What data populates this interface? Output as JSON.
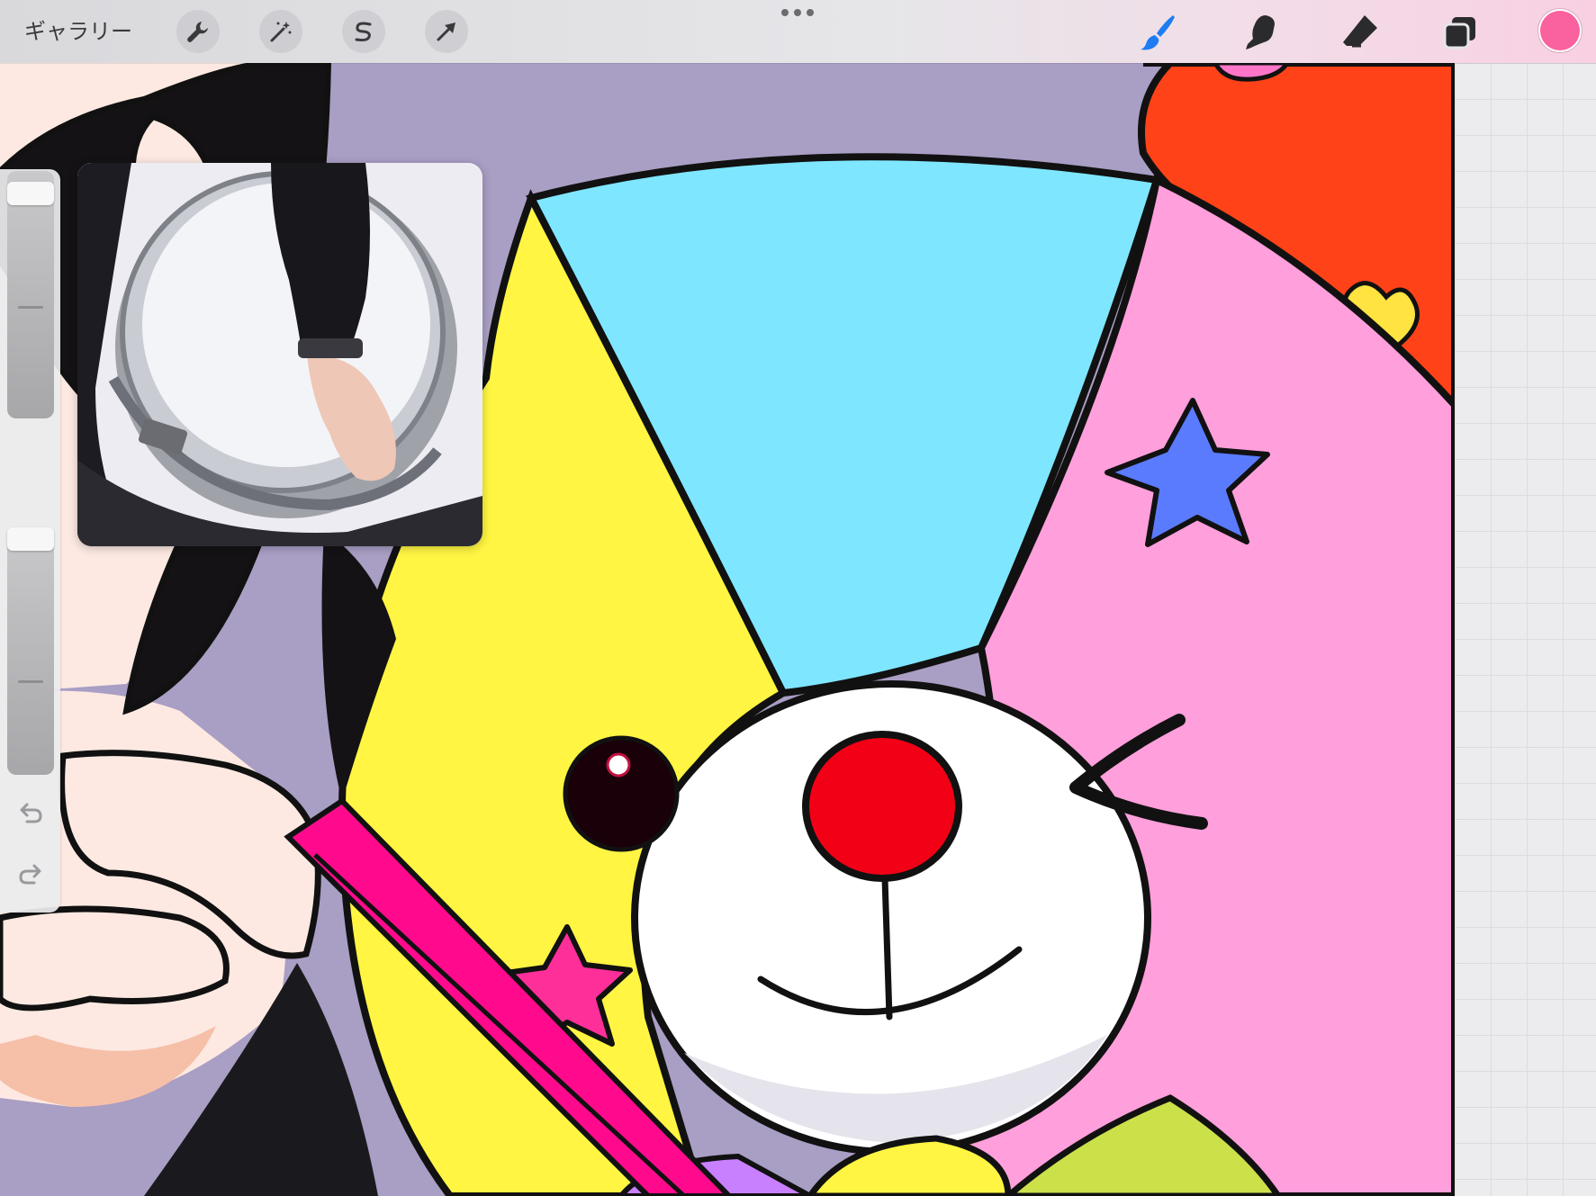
{
  "toolbar": {
    "gallery_label": "ギャラリー",
    "left_tools": [
      {
        "name": "actions",
        "icon": "wrench-icon"
      },
      {
        "name": "adjustments",
        "icon": "magic-wand-icon"
      },
      {
        "name": "selection",
        "icon": "selection-s-icon"
      },
      {
        "name": "transform",
        "icon": "arrow-cursor-icon"
      }
    ],
    "right_tools": [
      {
        "name": "brush",
        "icon": "brush-icon",
        "active": true
      },
      {
        "name": "smudge",
        "icon": "smudge-finger-icon",
        "active": false
      },
      {
        "name": "eraser",
        "icon": "eraser-icon",
        "active": false
      },
      {
        "name": "layers",
        "icon": "layers-icon",
        "active": false
      }
    ],
    "current_color": "#f9629f",
    "active_tool_color": "#1e7cf2"
  },
  "sidebar": {
    "brush_size_level": 0.95,
    "opacity_level": 1.0,
    "buttons": [
      {
        "name": "modify",
        "icon": "square-outline-icon"
      },
      {
        "name": "undo",
        "icon": "undo-arrow-icon"
      },
      {
        "name": "redo",
        "icon": "redo-arrow-icon"
      }
    ]
  },
  "reference_window": {
    "content": "snare-drum-photo"
  },
  "canvas": {
    "palette": {
      "background": "#a99ec4",
      "yellow": "#fff542",
      "blue": "#7fe6ff",
      "pink": "#ff9fdb",
      "red_hat": "#ff4218",
      "nose": "#f20016",
      "magenta": "#ff0a8c",
      "skin": "#fde9e2",
      "hair": "#141214",
      "star_blue": "#5b7bff",
      "star_pink": "#ff2f9a"
    }
  }
}
